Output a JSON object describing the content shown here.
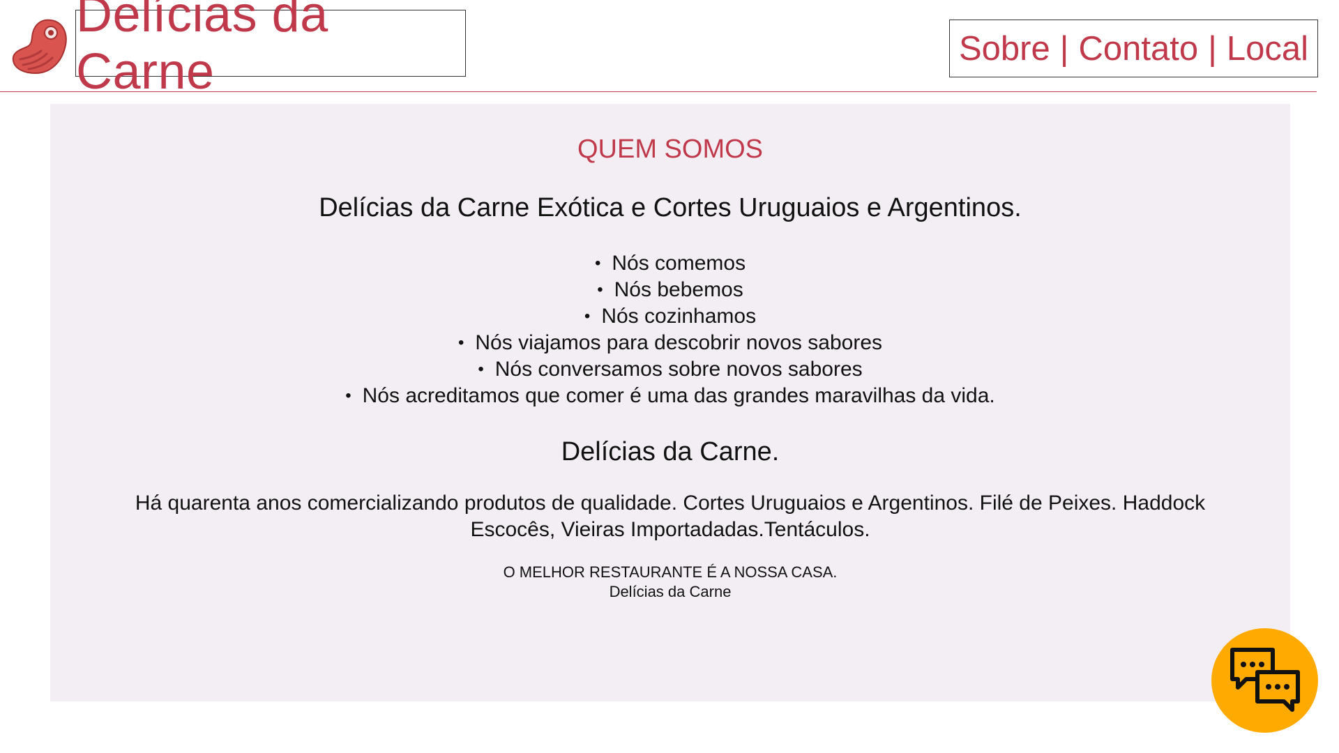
{
  "header": {
    "brand": "Delícias da Carne",
    "nav": {
      "about": "Sobre",
      "contact": "Contato",
      "location": "Local",
      "separator": "|"
    },
    "logo_icon": "meat-steak-icon",
    "accent_color": "#c0394b"
  },
  "main": {
    "section_title": "QUEM SOMOS",
    "subtitle": "Delícias da Carne Exótica e Cortes Uruguaios e Argentinos.",
    "bullets": [
      "Nós comemos",
      "Nós bebemos",
      "Nós cozinhamos",
      "Nós viajamos para descobrir novos sabores",
      "Nós conversamos sobre novos sabores",
      "Nós acreditamos que comer é uma das grandes maravilhas da vida."
    ],
    "heading2": "Delícias da Carne.",
    "paragraph": "Há quarenta anos comercializando produtos de qualidade. Cortes Uruguaios e Argentinos. Filé de Peixes. Haddock Escocês, Vieiras Importadadas.Tentáculos.",
    "motto_line1": "O MELHOR RESTAURANTE É A NOSSA CASA.",
    "motto_line2": "Delícias da Carne",
    "background_color": "#f3eef4"
  },
  "chat_widget": {
    "icon": "chat-bubbles-icon",
    "color": "#ffaa00"
  }
}
